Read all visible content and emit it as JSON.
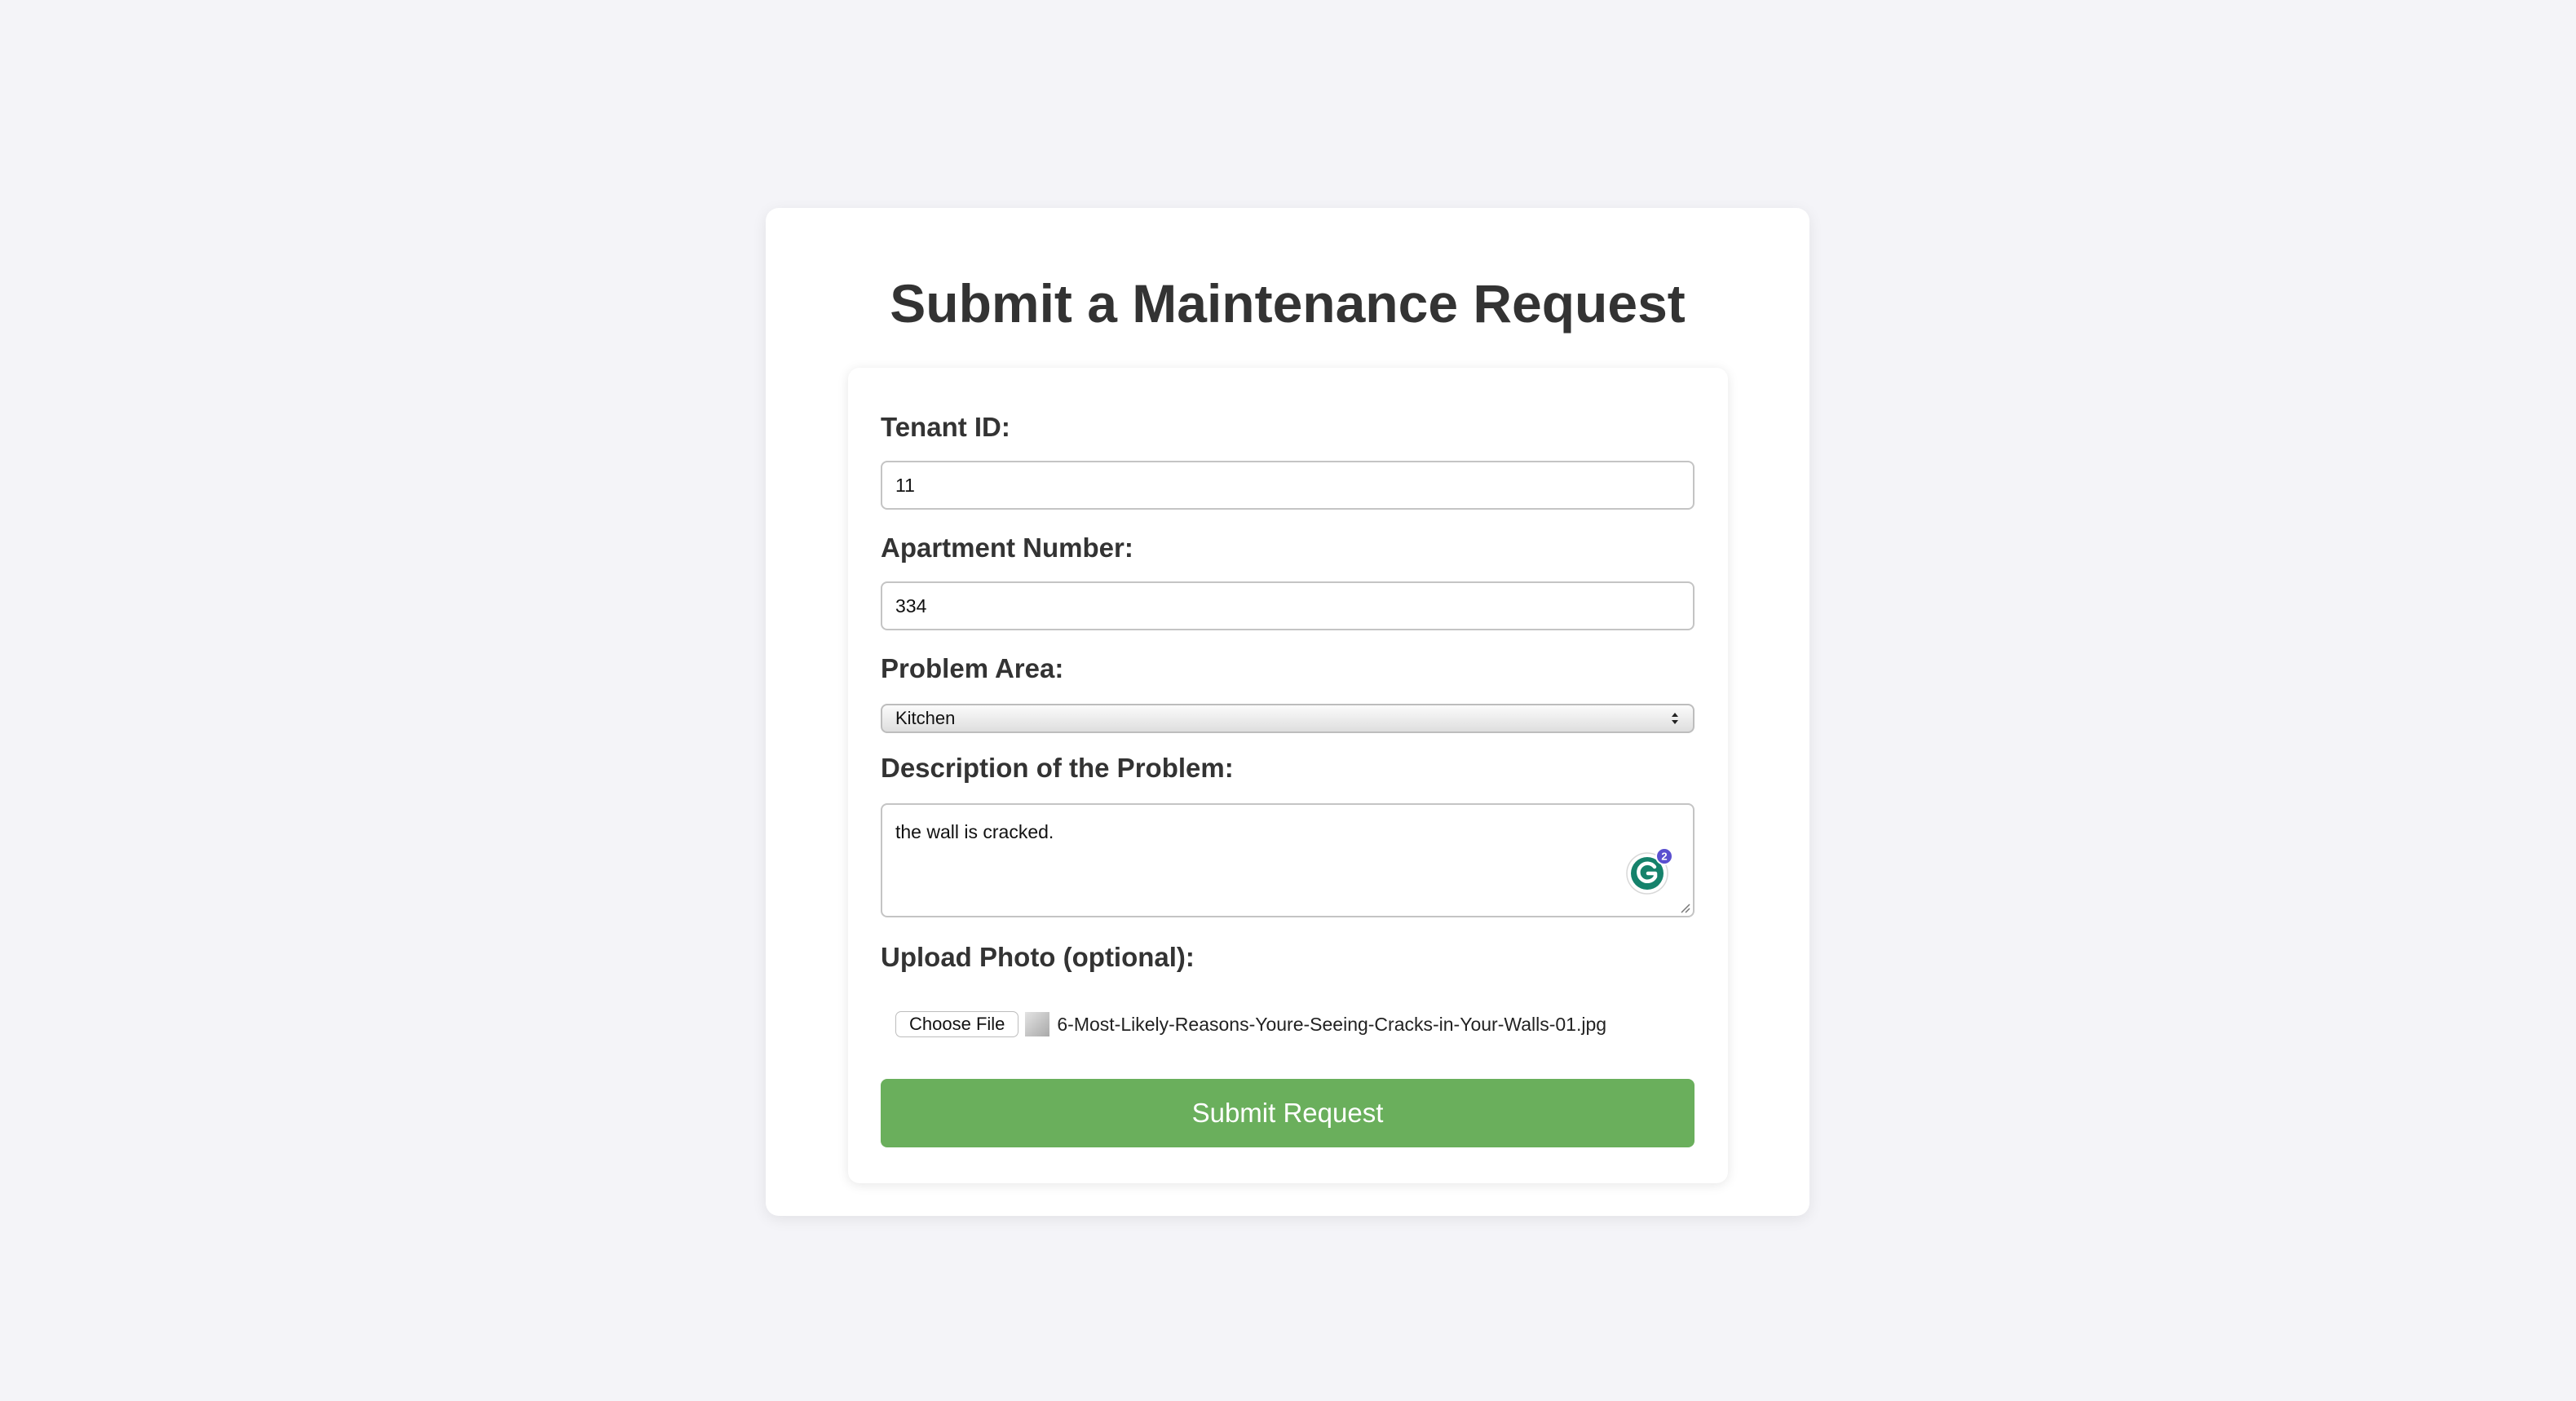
{
  "page": {
    "title": "Submit a Maintenance Request"
  },
  "form": {
    "tenant_id": {
      "label": "Tenant ID:",
      "value": "11"
    },
    "apartment_number": {
      "label": "Apartment Number:",
      "value": "334"
    },
    "problem_area": {
      "label": "Problem Area:",
      "selected": "Kitchen"
    },
    "description": {
      "label": "Description of the Problem:",
      "value": "the wall is cracked.",
      "grammarly_badge_count": "2"
    },
    "photo": {
      "label": "Upload Photo (optional):",
      "button_label": "Choose File",
      "file_name": "6-Most-Likely-Reasons-Youre-Seeing-Cracks-in-Your-Walls-01.jpg"
    },
    "submit_label": "Submit Request"
  },
  "colors": {
    "background": "#f4f4f8",
    "card": "#ffffff",
    "title_text": "#333333",
    "submit_button": "#6aaf5c",
    "grammarly_green": "#15826b",
    "grammarly_badge": "#5a4fcf"
  },
  "icons": {
    "grammarly": "grammarly-icon",
    "select_arrows": "chevron-up-down-icon",
    "resize": "resize-handle-icon"
  }
}
